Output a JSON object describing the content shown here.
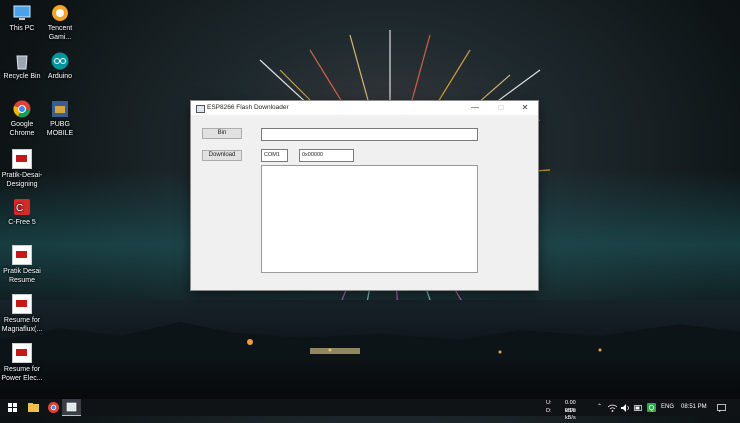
{
  "desktop": {
    "icons": [
      {
        "label": "This PC",
        "icon": "computer-icon",
        "color": "#4aa3e8"
      },
      {
        "label": "Tencent Gami...",
        "icon": "tencent-gaming-icon",
        "color": "#f2a32c"
      },
      {
        "label": "Recycle Bin",
        "icon": "recycle-bin-icon",
        "color": "#9aa7b0"
      },
      {
        "label": "Arduino",
        "icon": "arduino-icon",
        "color": "#00979c"
      },
      {
        "label": "Google Chrome",
        "icon": "chrome-icon",
        "color": "#db4437"
      },
      {
        "label": "PUBG MOBILE",
        "icon": "pubg-icon",
        "color": "#d4a640"
      },
      {
        "label": "Pratik-Desai-Designing",
        "icon": "pdf-icon",
        "color": "#c21b17"
      },
      {
        "label": "C-Free 5",
        "icon": "cfree-icon",
        "color": "#d62a2a"
      },
      {
        "label": "Pratik Desai Resume",
        "icon": "pdf-icon",
        "color": "#c21b17"
      },
      {
        "label": "Resume for Magnaflux(...",
        "icon": "pdf-icon",
        "color": "#c21b17"
      },
      {
        "label": "Resume for Power Elec...",
        "icon": "pdf-icon",
        "color": "#c21b17"
      }
    ]
  },
  "window": {
    "title": "ESP8266 Flash Downloader",
    "bin_button": "Bin",
    "download_button": "Download",
    "path_value": "",
    "com_port": "COM1",
    "address": "0x00000",
    "log": ""
  },
  "taskbar": {
    "upload_label": "U:",
    "download_label": "D:",
    "upload_speed": "0.00 kB/s",
    "download_speed": "0.00 kB/s",
    "language": "ENG",
    "time": "08:51 PM"
  }
}
